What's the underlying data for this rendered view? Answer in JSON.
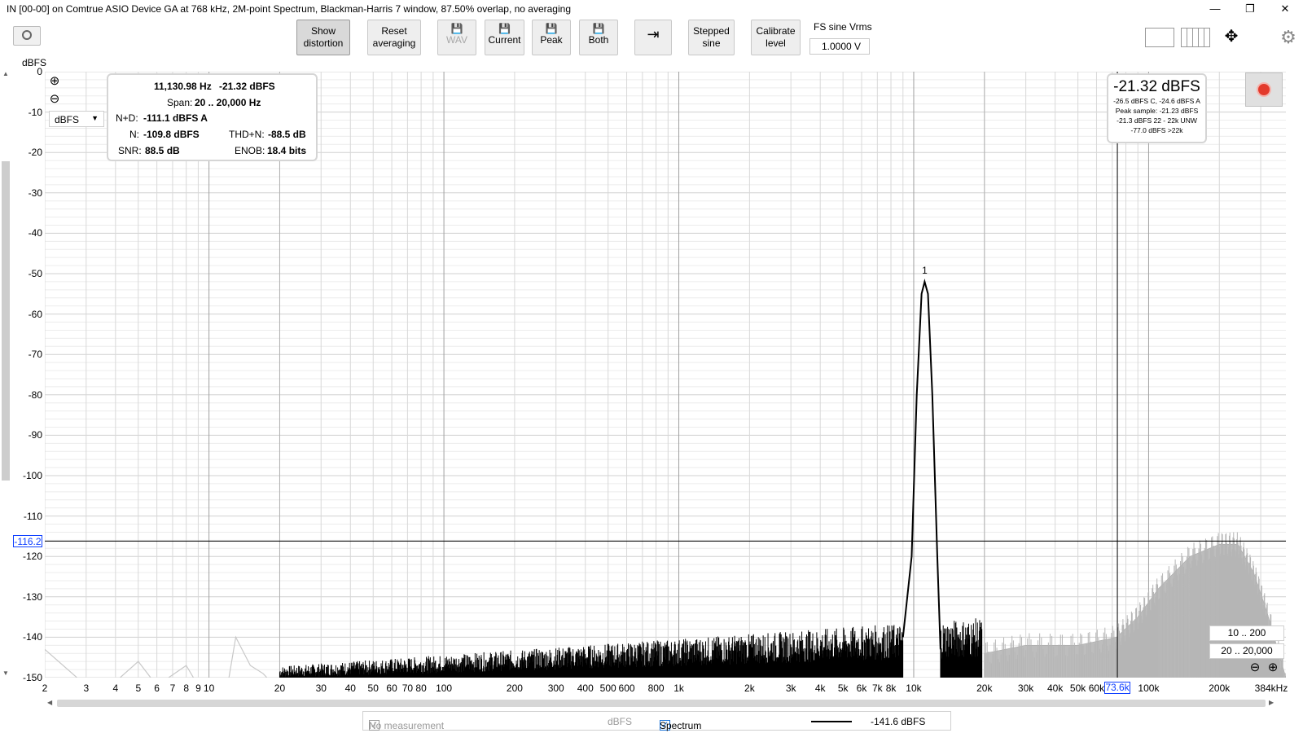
{
  "window": {
    "title": "IN [00-00] on Comtrue ASIO Device GA at 768 kHz, 2M-point Spectrum, Blackman-Harris 7 window, 87.50% overlap, no averaging",
    "minimize_icon": "minimize-icon",
    "restore_icon": "restore-icon",
    "close_icon": "close-icon"
  },
  "toolbar": {
    "show_distortion": [
      "Show",
      "distortion"
    ],
    "reset_averaging": [
      "Reset",
      "averaging"
    ],
    "wav": "WAV",
    "current": "Current",
    "peak": "Peak",
    "both": "Both",
    "stepped_sine": [
      "Stepped",
      "sine"
    ],
    "calibrate_level": [
      "Calibrate",
      "level"
    ],
    "fs_sine_label": "FS sine Vrms",
    "fs_sine_value": "1.0000 V"
  },
  "y_unit": "dBFS",
  "unit_select": "dBFS",
  "info": {
    "freq": "11,130.98 Hz",
    "level": "-21.32 dBFS",
    "span_label": "Span:",
    "span": "20 .. 20,000 Hz",
    "nd_label": "N+D:",
    "nd": "-111.1 dBFS A",
    "n_label": "N:",
    "n": "-109.8 dBFS",
    "thdn_label": "THD+N:",
    "thdn": "-88.5 dB",
    "snr_label": "SNR:",
    "snr": "88.5 dB",
    "enob_label": "ENOB:",
    "enob": "18.4 bits"
  },
  "readout": {
    "big": "-21.32 dBFS",
    "lines": [
      "-26.5 dBFS C, -24.6 dBFS A",
      "Peak sample: -21.23 dBFS",
      "-21.3 dBFS 22 - 22k UNW",
      "-77.0 dBFS >22k"
    ]
  },
  "cursor": {
    "y": "-116.2",
    "x": "73.6k"
  },
  "range_buttons": [
    "10 .. 200",
    "20 .. 20,000"
  ],
  "status": {
    "no_measurement": "No measurement",
    "unit": "dBFS",
    "spectrum": "Spectrum",
    "value": "-141.6 dBFS"
  },
  "chart_data": {
    "type": "line",
    "xscale": "log",
    "xlim": [
      2,
      384000
    ],
    "ylim": [
      -150,
      0
    ],
    "ylabel": "dBFS",
    "y_ticks": [
      "0",
      "-10",
      "-20",
      "-30",
      "-40",
      "-50",
      "-60",
      "-70",
      "-80",
      "-90",
      "-100",
      "-110",
      "-120",
      "-130",
      "-140",
      "-150"
    ],
    "x_ticks": [
      {
        "v": 2,
        "t": "2"
      },
      {
        "v": 3,
        "t": "3"
      },
      {
        "v": 4,
        "t": "4"
      },
      {
        "v": 5,
        "t": "5"
      },
      {
        "v": 6,
        "t": "6"
      },
      {
        "v": 7,
        "t": "7"
      },
      {
        "v": 8,
        "t": "8"
      },
      {
        "v": 9,
        "t": "9"
      },
      {
        "v": 10,
        "t": "10"
      },
      {
        "v": 20,
        "t": "20"
      },
      {
        "v": 30,
        "t": "30"
      },
      {
        "v": 40,
        "t": "40"
      },
      {
        "v": 50,
        "t": "50"
      },
      {
        "v": 60,
        "t": "60"
      },
      {
        "v": 70,
        "t": "70"
      },
      {
        "v": 80,
        "t": "80"
      },
      {
        "v": 100,
        "t": "100"
      },
      {
        "v": 200,
        "t": "200"
      },
      {
        "v": 300,
        "t": "300"
      },
      {
        "v": 400,
        "t": "400"
      },
      {
        "v": 500,
        "t": "500"
      },
      {
        "v": 600,
        "t": "600"
      },
      {
        "v": 800,
        "t": "800"
      },
      {
        "v": 1000,
        "t": "1k"
      },
      {
        "v": 2000,
        "t": "2k"
      },
      {
        "v": 3000,
        "t": "3k"
      },
      {
        "v": 4000,
        "t": "4k"
      },
      {
        "v": 5000,
        "t": "5k"
      },
      {
        "v": 6000,
        "t": "6k"
      },
      {
        "v": 7000,
        "t": "7k"
      },
      {
        "v": 8000,
        "t": "8k"
      },
      {
        "v": 10000,
        "t": "10k"
      },
      {
        "v": 20000,
        "t": "20k"
      },
      {
        "v": 30000,
        "t": "30k"
      },
      {
        "v": 40000,
        "t": "40k"
      },
      {
        "v": 50000,
        "t": "50k"
      },
      {
        "v": 60000,
        "t": "60k"
      },
      {
        "v": 100000,
        "t": "100k"
      },
      {
        "v": 200000,
        "t": "200k"
      },
      {
        "v": 384000,
        "t": "384kHz"
      }
    ],
    "peak": {
      "freq": 11130.98,
      "level": -52,
      "label": "1"
    },
    "cursor_freq": 73600,
    "cursor_level": -116.2,
    "spectrum_in_band": [
      [
        2,
        -143
      ],
      [
        3,
        -152
      ],
      [
        4,
        -151
      ],
      [
        5,
        -146
      ],
      [
        6,
        -152
      ],
      [
        8,
        -147
      ],
      [
        9,
        -152
      ],
      [
        12,
        -152
      ],
      [
        13,
        -140
      ],
      [
        15,
        -147
      ],
      [
        17,
        -149
      ],
      [
        19,
        -152
      ],
      [
        22,
        -149
      ],
      [
        30,
        -147
      ],
      [
        40,
        -147
      ],
      [
        60,
        -146
      ],
      [
        100,
        -145
      ],
      [
        200,
        -145
      ],
      [
        500,
        -144
      ],
      [
        1000,
        -144
      ],
      [
        2000,
        -143
      ],
      [
        5000,
        -142
      ],
      [
        8000,
        -142
      ],
      [
        9000,
        -140
      ],
      [
        9800,
        -120
      ],
      [
        10300,
        -80
      ],
      [
        10800,
        -55
      ],
      [
        11130,
        -52
      ],
      [
        11500,
        -55
      ],
      [
        12000,
        -80
      ],
      [
        12600,
        -120
      ],
      [
        13000,
        -143
      ],
      [
        15000,
        -144
      ],
      [
        19500,
        -144
      ]
    ],
    "spectrum_out_of_band": [
      [
        20000,
        -144
      ],
      [
        30000,
        -142
      ],
      [
        50000,
        -142
      ],
      [
        73000,
        -140
      ],
      [
        90000,
        -135
      ],
      [
        110000,
        -128
      ],
      [
        150000,
        -120
      ],
      [
        200000,
        -117
      ],
      [
        240000,
        -117
      ],
      [
        280000,
        -124
      ],
      [
        320000,
        -134
      ],
      [
        384000,
        -150
      ]
    ]
  }
}
